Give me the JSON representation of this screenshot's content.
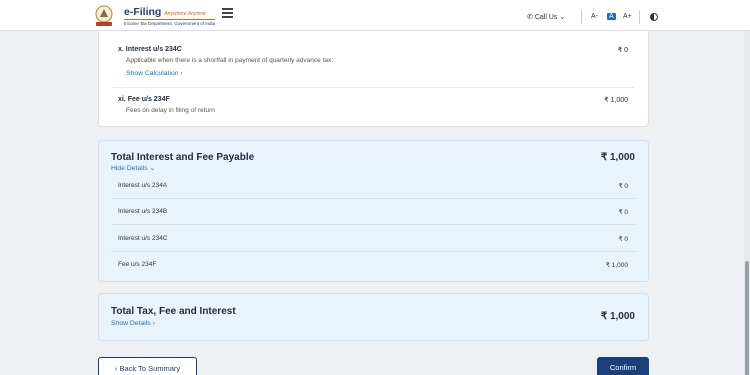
{
  "header": {
    "logo_title": "e-Filing",
    "logo_tagline": "Anywhere Anytime",
    "logo_subtitle": "Income Tax Department, Government of India",
    "call_us": "Call Us",
    "font_decrease": "A-",
    "font_default": "A",
    "font_increase": "A+",
    "icons": [
      "emblem-icon",
      "menu-icon",
      "phone-icon",
      "chevron-down-icon",
      "contrast-icon"
    ]
  },
  "interest_section": {
    "item_x": {
      "title": "x. Interest u/s 234C",
      "description": "Applicable when there is a shortfall in payment of quarterly advance tax.",
      "amount": "₹ 0",
      "link": "Show Calculation"
    },
    "item_xi": {
      "title": "xi. Fee u/s 234F",
      "description": "Fees on delay in filing of return",
      "amount": "₹ 1,000"
    }
  },
  "total_interest_fee": {
    "title": "Total Interest and Fee Payable",
    "amount": "₹ 1,000",
    "toggle_label": "Hide Details",
    "rows": [
      {
        "label": "Interest u/s 234A",
        "amount": "₹ 0"
      },
      {
        "label": "Interest u/s 234B",
        "amount": "₹ 0"
      },
      {
        "label": "Interest u/s 234C",
        "amount": "₹ 0"
      },
      {
        "label": "Fee u/s 234F",
        "amount": "₹ 1,000"
      }
    ]
  },
  "total_tax": {
    "title": "Total Tax, Fee and Interest",
    "amount": "₹ 1,000",
    "toggle_label": "Show Details"
  },
  "actions": {
    "back_label": "Back To Summary",
    "confirm_label": "Confirm"
  },
  "colors": {
    "primary": "#1b3f7a",
    "link": "#1b6fc8",
    "panel_bg": "#e9f3fb",
    "page_bg": "#eef0f3"
  }
}
